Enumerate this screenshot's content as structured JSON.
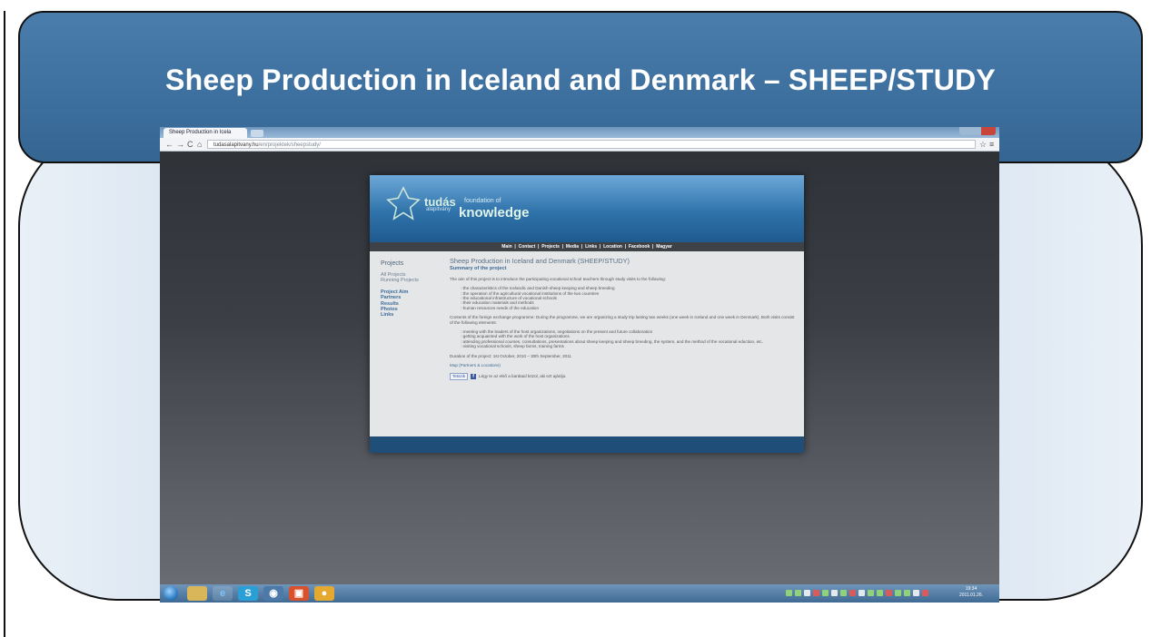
{
  "slide": {
    "title": "Sheep Production in Iceland and Denmark – SHEEP/STUDY"
  },
  "browser": {
    "tab_title": "Sheep Production in Icela",
    "url_host": "tudasalapitvany.hu",
    "url_path": "/en/projektek/sheepstudy/"
  },
  "site": {
    "logo_name": "tudás",
    "logo_sub": "alapitvány",
    "logo_found": "foundation of",
    "logo_knowledge": "knowledge",
    "nav": [
      "Main",
      "Contact",
      "Projects",
      "Media",
      "Links",
      "Location",
      "Facebook",
      "Magyar"
    ],
    "sidebar": {
      "title": "Projects",
      "group1": [
        "All Projects",
        "Running Projects"
      ],
      "group2": [
        "Project Aim",
        "Partners",
        "Results",
        "Photos",
        "Links"
      ]
    },
    "main": {
      "title": "Sheep Production in Iceland and Denmark (SHEEP/STUDY)",
      "subtitle": "Summary of the project",
      "intro": "The aim of this project is to introduce the participating vocational school teachers through study visits to the following:",
      "aims": [
        "the characteristics of the Icelandic and Danish sheep keeping and sheep breeding",
        "the operation of the agricultural vocational institutions of the two countries",
        "the educational infrastructure of vocational schools",
        "their education materials and methods",
        "human resources needs of the education"
      ],
      "contents": "Contents of the foreign exchange programme: During the programme, we are organizing a study trip lasting two weeks (one week in Iceland and one week in Denmark). Both visits consist of the following elements:",
      "elements": [
        "meeting with the leaders of the host organizations, negotiations on the present and future collaboration",
        "getting acquainted with the work of the host organizations",
        "attending professional courses, consultations, presentations about sheep keeping and sheep breeding, the system, and the method of the vocational eduction, etc.",
        "visiting vocational schools, sheep farms, training farms"
      ],
      "duration": "Duration of the project: 1st October, 2010 – 30th September, 2011",
      "map_link": "Map (Partners & Locations)",
      "like_label": "Tetszik",
      "like_text": "Légy te az első a barátaid közül, aki ezt ajánlja."
    }
  },
  "taskbar": {
    "clock_time": "19:34",
    "clock_date": "2011.01.26."
  }
}
